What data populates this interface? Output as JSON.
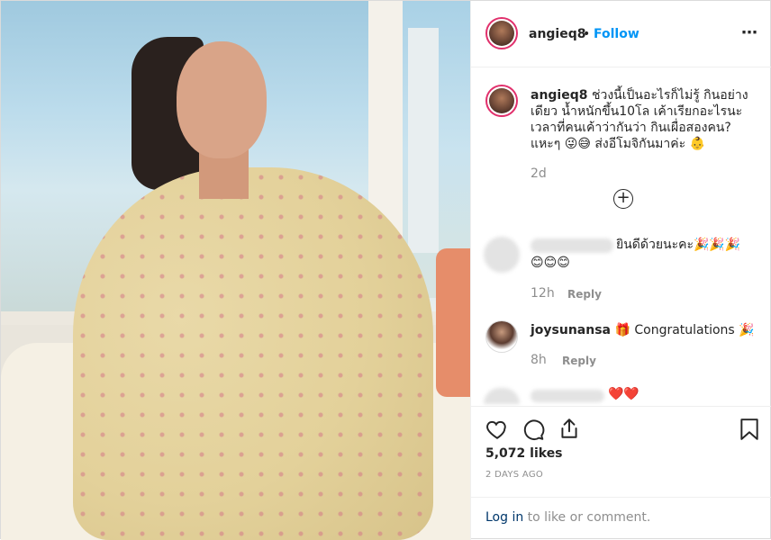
{
  "post": {
    "username": "angieq8",
    "follow_label": "Follow",
    "separator": "•",
    "more_label": "•••",
    "caption_text": "ช่วงนี้เป็นอะไรก็ไม่รู้ กินอย่างเดียว น้ำหนักขึ้น10โล เค้าเรียกอะไรนะ เวลาที่คนเค้าว่ากันว่า กินเผื่อสองคน? แหะๆ 😜😅  ส่งอีโมจิกันมาค่ะ 👶",
    "caption_time": "2d",
    "load_more_label": "+"
  },
  "comments": [
    {
      "username": "",
      "text": "ยินดีด้วยนะคะ🎉🎉🎉",
      "text2": "😊😊😊",
      "time": "12h",
      "reply": "Reply"
    },
    {
      "username": "joysunansa",
      "text": "🎁 Congratulations 🎉",
      "time": "8h",
      "reply": "Reply"
    },
    {
      "username": "",
      "text": "❤️❤️"
    }
  ],
  "actions": {
    "likes": "5,072 likes",
    "posted_ago": "2 DAYS AGO",
    "login_link": "Log in",
    "login_rest": " to like or comment."
  },
  "icons": [
    "heart-icon",
    "comment-icon",
    "share-icon",
    "bookmark-icon",
    "add-circle-icon",
    "more-options-icon"
  ],
  "colors": {
    "link": "#0095f6",
    "muted": "#8e8e8e",
    "text": "#262626",
    "border": "#efefef",
    "story_ring": "#e1306c"
  }
}
